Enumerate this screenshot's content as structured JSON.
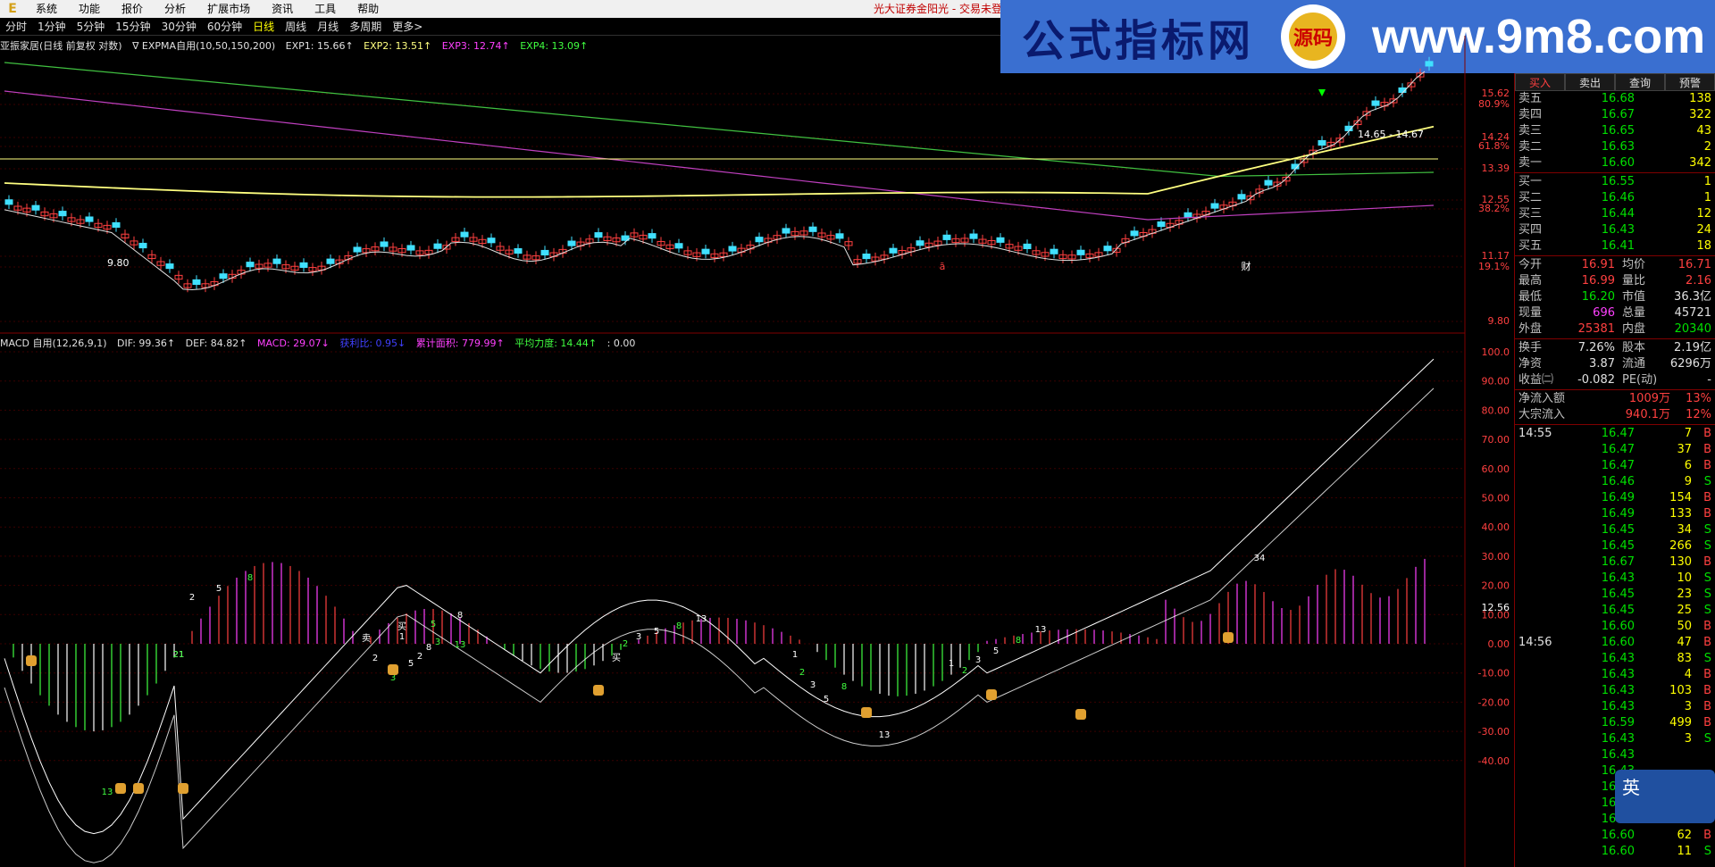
{
  "menubar": {
    "logo": "E",
    "items": [
      "系统",
      "功能",
      "报价",
      "分析",
      "扩展市场",
      "资讯",
      "工具",
      "帮助"
    ],
    "broker": "光大证券金阳光 - 交易未登"
  },
  "banner": {
    "chinese": "公式指标网",
    "badge": "源码",
    "url": "www.9m8.com"
  },
  "periods": {
    "items": [
      "分时",
      "1分钟",
      "5分钟",
      "15分钟",
      "30分钟",
      "60分钟",
      "日线",
      "周线",
      "月线",
      "多周期",
      "更多>"
    ],
    "active": "日线"
  },
  "expma_bar": {
    "stock": "亚振家居(日线 前复权 对数)",
    "indicator": "∇ EXPMA自用(10,50,150,200)",
    "exp1": "EXP1: 15.66↑",
    "exp2": "EXP2: 13.51↑",
    "exp3": "EXP3: 12.74↑",
    "exp4": "EXP4: 13.09↑"
  },
  "macd_bar": {
    "indicator": "MACD 自用(12,26,9,1)",
    "dif": "DIF: 99.36↑",
    "def": "DEF: 84.82↑",
    "macd": "MACD: 29.07↓",
    "huoli": "获利比: 0.95↓",
    "leiji": "累计面积: 779.99↑",
    "pingjun": "平均力度: 14.44↑",
    "extra": ": 0.00"
  },
  "price_axis": [
    "15.62",
    "80.9%",
    "14.24",
    "61.8%",
    "13.39",
    "12.55",
    "38.2%",
    "11.17",
    "19.1%",
    "9.80"
  ],
  "price_annotations": {
    "low": "9.80",
    "range": "14.65 - 14.67",
    "cai": "财",
    "mark": "ā"
  },
  "macd_axis": [
    "100.0",
    "90.00",
    "80.00",
    "70.00",
    "60.00",
    "50.00",
    "40.00",
    "30.00",
    "20.00",
    "12.56",
    "10.00",
    "0.00",
    "-10.00",
    "-20.00",
    "-30.00",
    "-40.00"
  ],
  "macd_labels": [
    "13",
    "2",
    "5",
    "8",
    "21",
    "2",
    "3",
    "5",
    "8",
    "13",
    "1",
    "2",
    "3",
    "卖",
    "买",
    "5",
    "8",
    "买",
    "2",
    "3",
    "5",
    "8",
    "13",
    "1",
    "2",
    "3",
    "5",
    "8",
    "13",
    "1",
    "2",
    "3",
    "5",
    "8",
    "13",
    "34",
    "21"
  ],
  "panel": {
    "buttons": [
      "买入",
      "卖出",
      "查询",
      "预警"
    ],
    "asks": [
      {
        "label": "卖五",
        "price": "16.68",
        "vol": "138"
      },
      {
        "label": "卖四",
        "price": "16.67",
        "vol": "322"
      },
      {
        "label": "卖三",
        "price": "16.65",
        "vol": "43"
      },
      {
        "label": "卖二",
        "price": "16.63",
        "vol": "2"
      },
      {
        "label": "卖一",
        "price": "16.60",
        "vol": "342"
      }
    ],
    "bids": [
      {
        "label": "买一",
        "price": "16.55",
        "vol": "1"
      },
      {
        "label": "买二",
        "price": "16.46",
        "vol": "1"
      },
      {
        "label": "买三",
        "price": "16.44",
        "vol": "12"
      },
      {
        "label": "买四",
        "price": "16.43",
        "vol": "24"
      },
      {
        "label": "买五",
        "price": "16.41",
        "vol": "18"
      }
    ],
    "stats1": [
      {
        "l1": "今开",
        "v1": "16.91",
        "c1": "red",
        "l2": "均价",
        "v2": "16.71",
        "c2": "red"
      },
      {
        "l1": "最高",
        "v1": "16.99",
        "c1": "red",
        "l2": "量比",
        "v2": "2.16",
        "c2": "red"
      },
      {
        "l1": "最低",
        "v1": "16.20",
        "c1": "green",
        "l2": "市值",
        "v2": "36.3亿",
        "c2": "white"
      },
      {
        "l1": "现量",
        "v1": "696",
        "c1": "magenta",
        "l2": "总量",
        "v2": "45721",
        "c2": "white"
      },
      {
        "l1": "外盘",
        "v1": "25381",
        "c1": "red",
        "l2": "内盘",
        "v2": "20340",
        "c2": "green"
      }
    ],
    "stats2": [
      {
        "l1": "换手",
        "v1": "7.26%",
        "c1": "white",
        "l2": "股本",
        "v2": "2.19亿",
        "c2": "white"
      },
      {
        "l1": "净资",
        "v1": "3.87",
        "c1": "white",
        "l2": "流通",
        "v2": "6296万",
        "c2": "white"
      },
      {
        "l1": "收益㈡",
        "v1": "-0.082",
        "c1": "white",
        "l2": "PE(动)",
        "v2": "-",
        "c2": "white"
      }
    ],
    "flows": [
      {
        "label": "净流入额",
        "val": "1009万",
        "pct": "13%"
      },
      {
        "label": "大宗流入",
        "val": "940.1万",
        "pct": "12%"
      }
    ],
    "ticks": [
      {
        "t": "14:55",
        "p": "16.47",
        "pc": "green",
        "q": "7",
        "d": "B",
        "dc": "red"
      },
      {
        "t": "",
        "p": "16.47",
        "pc": "green",
        "q": "37",
        "d": "B",
        "dc": "red"
      },
      {
        "t": "",
        "p": "16.47",
        "pc": "green",
        "q": "6",
        "d": "B",
        "dc": "red"
      },
      {
        "t": "",
        "p": "16.46",
        "pc": "green",
        "q": "9",
        "d": "S",
        "dc": "green"
      },
      {
        "t": "",
        "p": "16.49",
        "pc": "green",
        "q": "154",
        "d": "B",
        "dc": "red"
      },
      {
        "t": "",
        "p": "16.49",
        "pc": "green",
        "q": "133",
        "d": "B",
        "dc": "red"
      },
      {
        "t": "",
        "p": "16.45",
        "pc": "green",
        "q": "34",
        "d": "S",
        "dc": "green"
      },
      {
        "t": "",
        "p": "16.45",
        "pc": "green",
        "q": "266",
        "d": "S",
        "dc": "green"
      },
      {
        "t": "",
        "p": "16.67",
        "pc": "green",
        "q": "130",
        "d": "B",
        "dc": "red"
      },
      {
        "t": "",
        "p": "16.43",
        "pc": "green",
        "q": "10",
        "d": "S",
        "dc": "green"
      },
      {
        "t": "",
        "p": "16.45",
        "pc": "green",
        "q": "23",
        "d": "S",
        "dc": "green"
      },
      {
        "t": "",
        "p": "16.45",
        "pc": "green",
        "q": "25",
        "d": "S",
        "dc": "green"
      },
      {
        "t": "",
        "p": "16.60",
        "pc": "green",
        "q": "50",
        "d": "B",
        "dc": "red"
      },
      {
        "t": "14:56",
        "p": "16.60",
        "pc": "green",
        "q": "47",
        "d": "B",
        "dc": "red"
      },
      {
        "t": "",
        "p": "16.43",
        "pc": "green",
        "q": "83",
        "d": "S",
        "dc": "green"
      },
      {
        "t": "",
        "p": "16.43",
        "pc": "green",
        "q": "4",
        "d": "B",
        "dc": "red"
      },
      {
        "t": "",
        "p": "16.43",
        "pc": "green",
        "q": "103",
        "d": "B",
        "dc": "red"
      },
      {
        "t": "",
        "p": "16.43",
        "pc": "green",
        "q": "3",
        "d": "B",
        "dc": "red"
      },
      {
        "t": "",
        "p": "16.59",
        "pc": "green",
        "q": "499",
        "d": "B",
        "dc": "red"
      },
      {
        "t": "",
        "p": "16.43",
        "pc": "green",
        "q": "3",
        "d": "S",
        "dc": "green"
      },
      {
        "t": "",
        "p": "16.43",
        "pc": "green",
        "q": "",
        "d": "",
        "dc": "green"
      },
      {
        "t": "",
        "p": "16.43",
        "pc": "green",
        "q": "",
        "d": "",
        "dc": "green"
      },
      {
        "t": "",
        "p": "16.43",
        "pc": "green",
        "q": "",
        "d": "",
        "dc": "green"
      },
      {
        "t": "",
        "p": "16.43",
        "pc": "green",
        "q": "",
        "d": "",
        "dc": "green"
      },
      {
        "t": "",
        "p": "16.44",
        "pc": "green",
        "q": "125",
        "d": "S",
        "dc": "green"
      },
      {
        "t": "",
        "p": "16.60",
        "pc": "green",
        "q": "62",
        "d": "B",
        "dc": "red"
      },
      {
        "t": "",
        "p": "16.60",
        "pc": "green",
        "q": "11",
        "d": "S",
        "dc": "green"
      }
    ]
  },
  "ime": "英"
}
